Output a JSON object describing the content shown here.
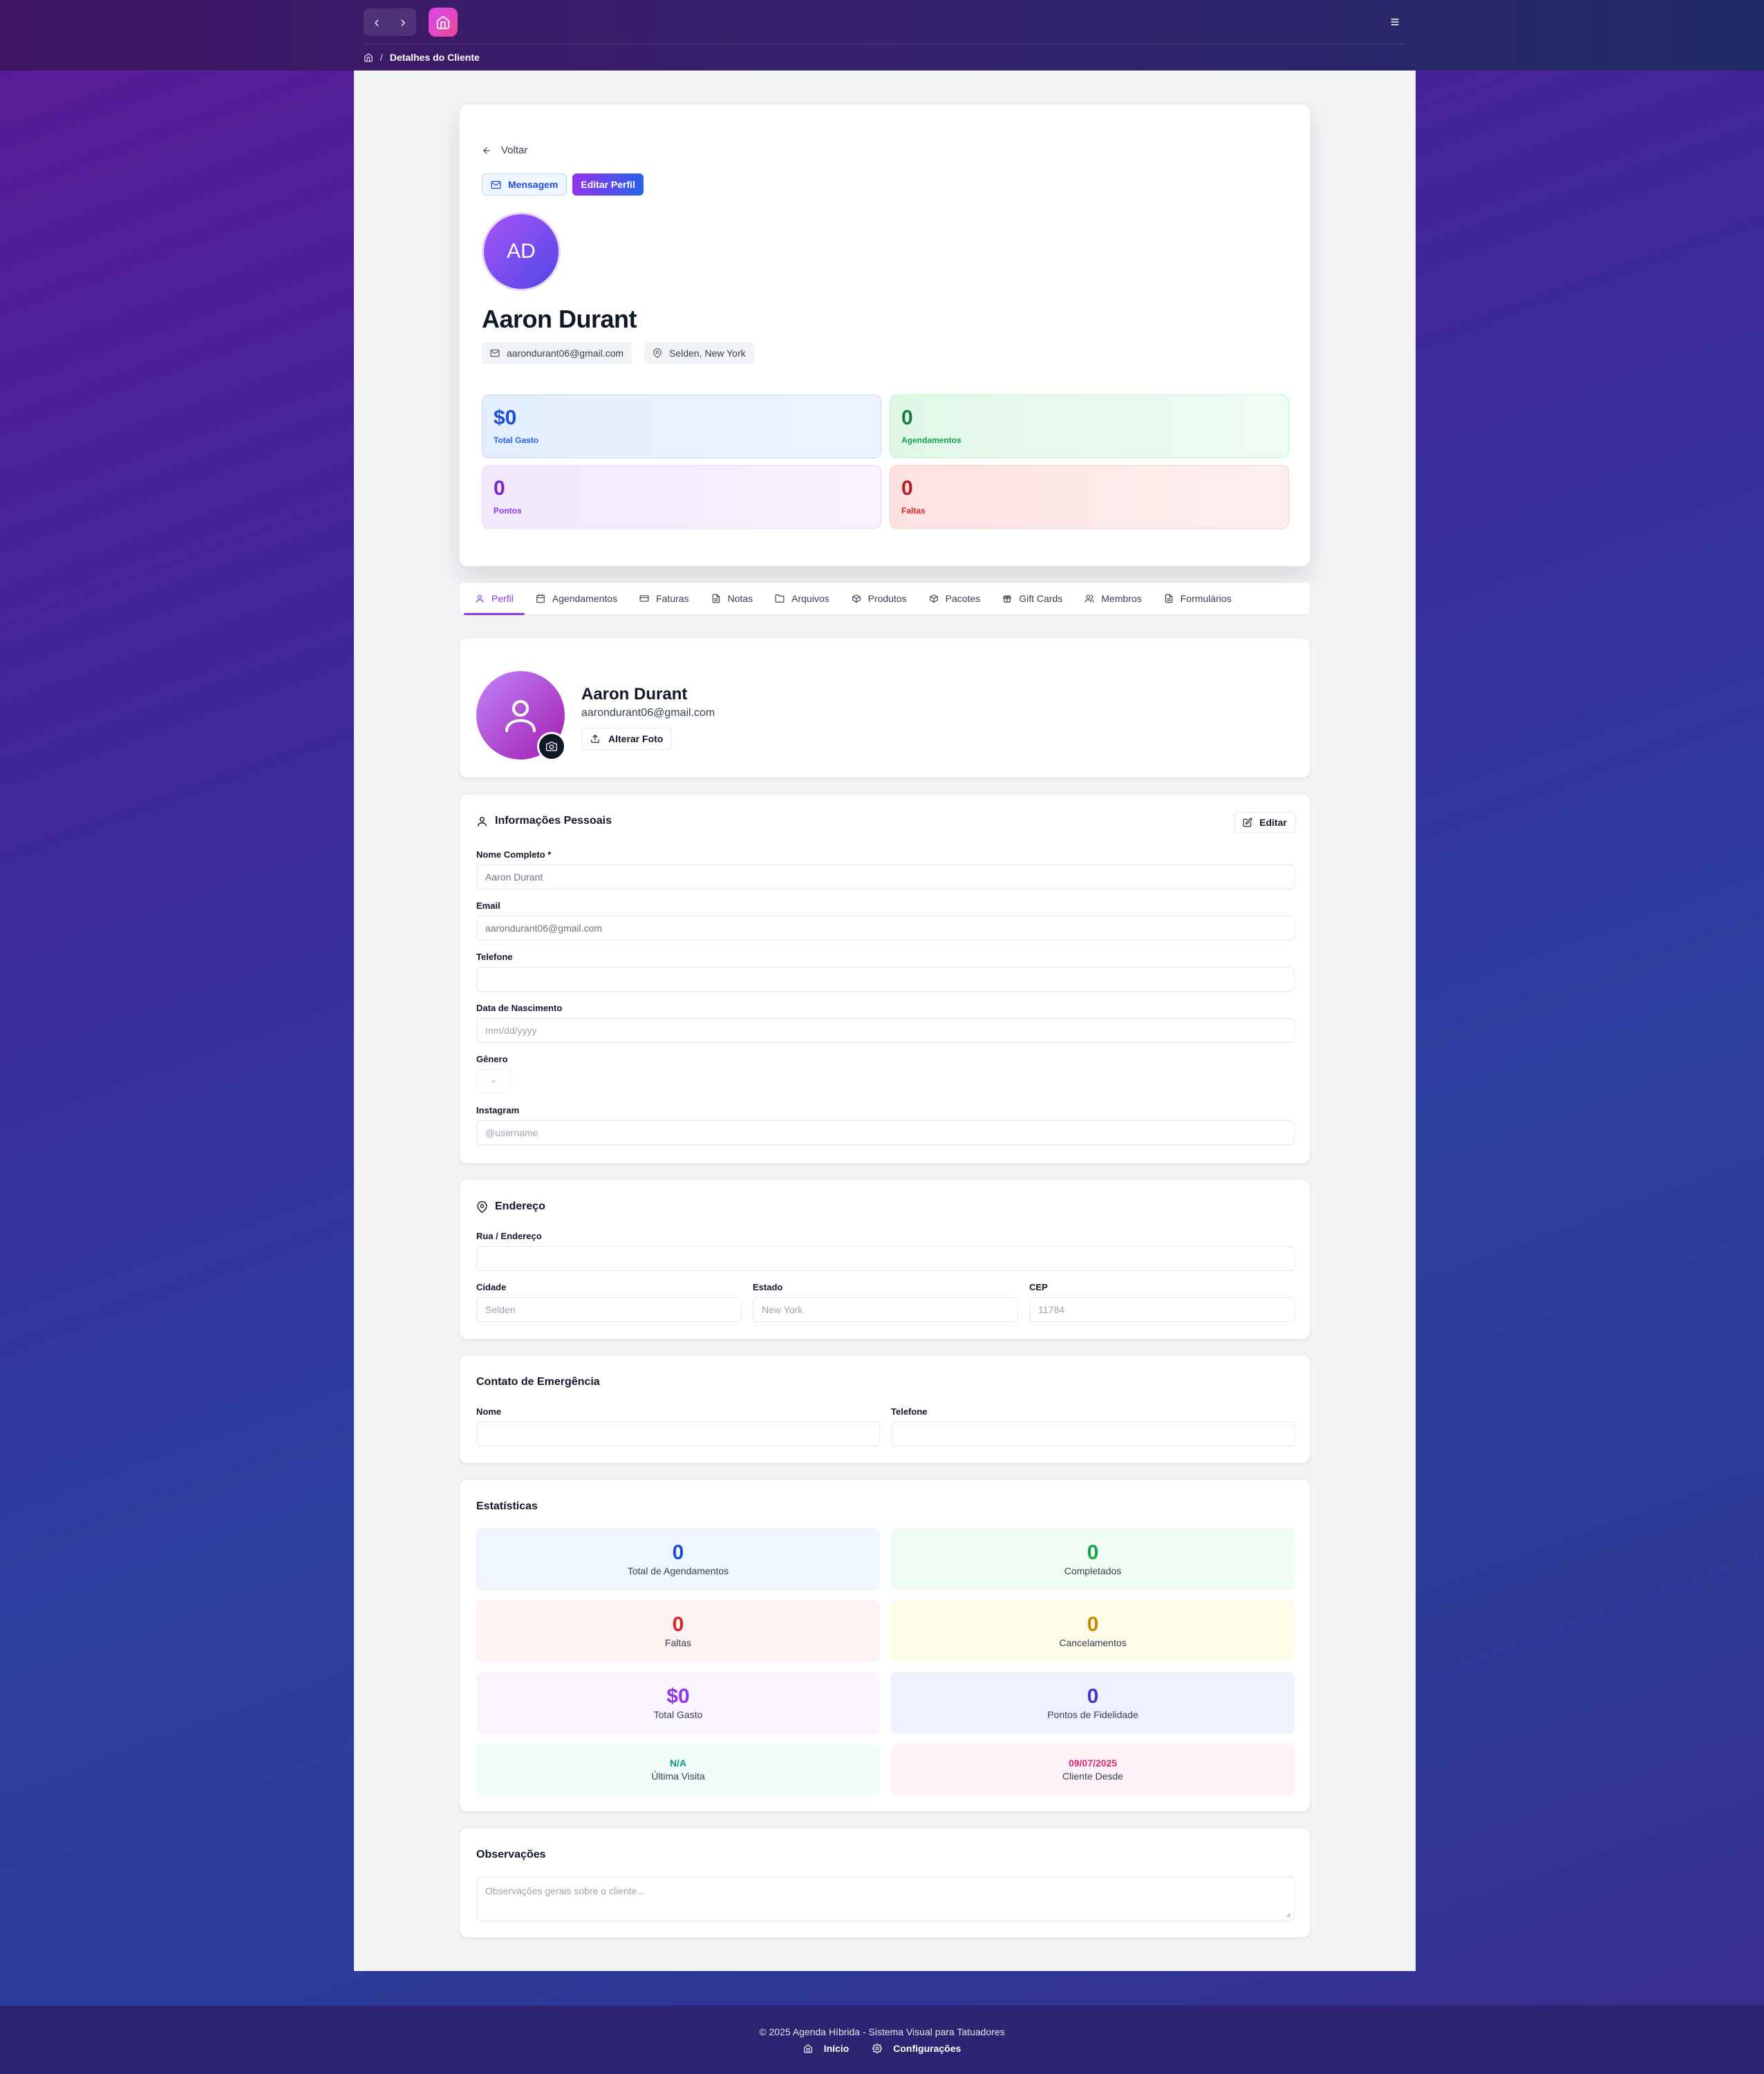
{
  "topbar": {
    "back_glyph": "‹",
    "forward_glyph": "›",
    "menu_glyph": "≡",
    "breadcrumb_sep": "/",
    "breadcrumb_current": "Detalhes do Cliente"
  },
  "hero": {
    "back_label": "Voltar",
    "message_label": "Mensagem",
    "edit_profile_label": "Editar Perfil",
    "initials": "AD",
    "name": "Aaron Durant",
    "email": "aarondurant06@gmail.com",
    "location": "Selden, New York",
    "stats": [
      {
        "value": "$0",
        "label": "Total Gasto",
        "color": "#1d4ed8"
      },
      {
        "value": "0",
        "label": "Agendamentos",
        "color": "#15803d"
      },
      {
        "value": "0",
        "label": "Pontos",
        "color": "#7e22ce"
      },
      {
        "value": "0",
        "label": "Faltas",
        "color": "#b91c1c"
      }
    ]
  },
  "tabs": [
    {
      "label": "Perfil",
      "icon": "user-icon",
      "active": true
    },
    {
      "label": "Agendamentos",
      "icon": "calendar-icon"
    },
    {
      "label": "Faturas",
      "icon": "credit-card-icon"
    },
    {
      "label": "Notas",
      "icon": "file-text-icon"
    },
    {
      "label": "Arquivos",
      "icon": "folder-icon"
    },
    {
      "label": "Produtos",
      "icon": "package-icon"
    },
    {
      "label": "Pacotes",
      "icon": "package-icon"
    },
    {
      "label": "Gift Cards",
      "icon": "gift-icon"
    },
    {
      "label": "Membros",
      "icon": "users-icon"
    },
    {
      "label": "Formulários",
      "icon": "file-icon"
    }
  ],
  "profile_card": {
    "name": "Aaron Durant",
    "email": "aarondurant06@gmail.com",
    "change_photo_label": "Alterar Foto"
  },
  "personal": {
    "title": "Informações Pessoais",
    "edit_label": "Editar",
    "full_name_label": "Nome Completo *",
    "full_name_value": "Aaron Durant",
    "email_label": "Email",
    "email_value": "aarondurant06@gmail.com",
    "phone_label": "Telefone",
    "phone_value": "",
    "birth_label": "Data de Nascimento",
    "birth_placeholder": "mm/dd/yyyy",
    "gender_label": "Gênero",
    "gender_value": "",
    "instagram_label": "Instagram",
    "instagram_placeholder": "@username"
  },
  "address": {
    "title": "Endereço",
    "street_label": "Rua / Endereço",
    "street_value": "",
    "city_label": "Cidade",
    "city_value": "Selden",
    "state_label": "Estado",
    "state_value": "New York",
    "zip_label": "CEP",
    "zip_value": "11784"
  },
  "emergency": {
    "title": "Contato de Emergência",
    "name_label": "Nome",
    "phone_label": "Telefone"
  },
  "statistics": {
    "title": "Estatísticas",
    "tiles": [
      {
        "value": "0",
        "label": "Total de Agendamentos",
        "color": "#1d4ed8",
        "bg": "#eff6ff"
      },
      {
        "value": "0",
        "label": "Completados",
        "color": "#16a34a",
        "bg": "#f0fdf4"
      },
      {
        "value": "0",
        "label": "Faltas",
        "color": "#dc2626",
        "bg": "#fef2f2"
      },
      {
        "value": "0",
        "label": "Cancelamentos",
        "color": "#ca8a04",
        "bg": "#fefce8"
      },
      {
        "value": "$0",
        "label": "Total Gasto",
        "color": "#9333ea",
        "bg": "#faf5ff"
      },
      {
        "value": "0",
        "label": "Pontos de Fidelidade",
        "color": "#4338ca",
        "bg": "#eef2ff"
      },
      {
        "value": "N/A",
        "label": "Última Visita",
        "color": "#0d9488",
        "bg": "#f0fdfa"
      },
      {
        "value": "09/07/2025",
        "label": "Cliente Desde",
        "color": "#db2777",
        "bg": "#fdf2f8"
      }
    ]
  },
  "notes": {
    "title": "Observações",
    "placeholder": "Observações gerais sobre o cliente..."
  },
  "footer": {
    "copyright": "© 2025 Agenda Híbrida - Sistema Visual para Tatuadores",
    "home_label": "Início",
    "settings_label": "Configurações"
  }
}
